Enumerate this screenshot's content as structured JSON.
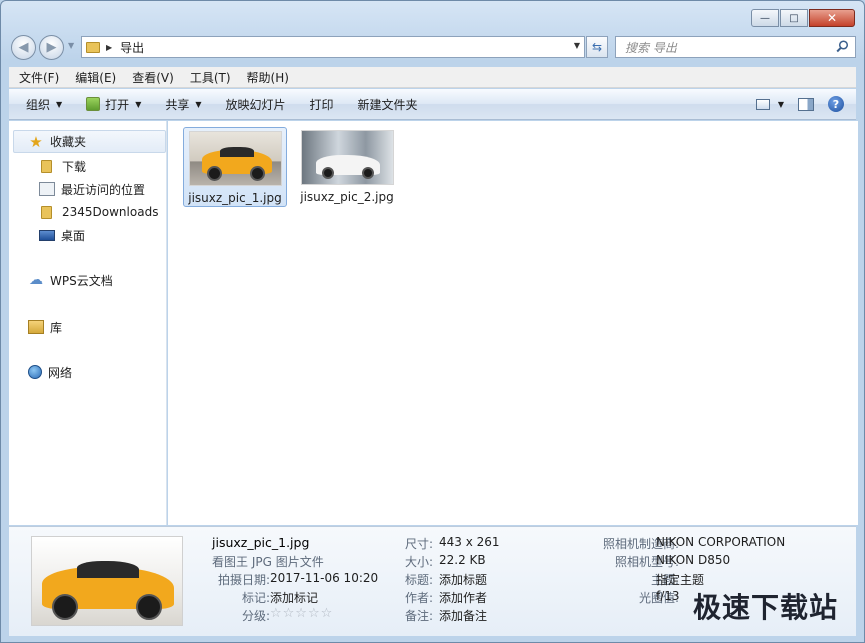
{
  "window": {
    "caption_buttons": {
      "minimize": "—",
      "maximize": "□",
      "close": "✕"
    }
  },
  "address_bar": {
    "path": "导出"
  },
  "search": {
    "placeholder": "搜索 导出"
  },
  "menu": [
    "文件(F)",
    "编辑(E)",
    "查看(V)",
    "工具(T)",
    "帮助(H)"
  ],
  "toolbar": {
    "organize": "组织",
    "open": "打开",
    "share": "共享",
    "slideshow": "放映幻灯片",
    "print": "打印",
    "new_folder": "新建文件夹"
  },
  "sidebar": {
    "favorites": {
      "label": "收藏夹",
      "items": [
        "下载",
        "最近访问的位置",
        "2345Downloads",
        "桌面"
      ]
    },
    "wps_cloud": "WPS云文档",
    "library": "库",
    "network": "网络"
  },
  "files": [
    {
      "name": "jisuxz_pic_1.jpg",
      "selected": true
    },
    {
      "name": "jisuxz_pic_2.jpg",
      "selected": false
    }
  ],
  "details": {
    "file_name": "jisuxz_pic_1.jpg",
    "file_type": "看图王 JPG 图片文件",
    "col1": [
      {
        "label": "拍摄日期:",
        "value": "2017-11-06 10:20"
      },
      {
        "label": "标记:",
        "value": "添加标记"
      },
      {
        "label": "分级:",
        "value": "☆☆☆☆☆"
      }
    ],
    "col2": [
      {
        "label": "尺寸:",
        "value": "443 x 261"
      },
      {
        "label": "大小:",
        "value": "22.2 KB"
      },
      {
        "label": "标题:",
        "value": "添加标题"
      },
      {
        "label": "作者:",
        "value": "添加作者"
      },
      {
        "label": "备注:",
        "value": "添加备注"
      }
    ],
    "col3": [
      {
        "label": "照相机制造商:",
        "value": "NIKON CORPORATION"
      },
      {
        "label": "照相机型号:",
        "value": "NIKON D850"
      },
      {
        "label": "主题:",
        "value": "指定主题"
      },
      {
        "label": "光圈值:",
        "value": "f/13"
      }
    ]
  },
  "watermark": "极速下载站",
  "colors": {
    "selection": "#d2e3f7",
    "accent": "#3b6fb0",
    "car_yellow": "#f2a81d"
  }
}
